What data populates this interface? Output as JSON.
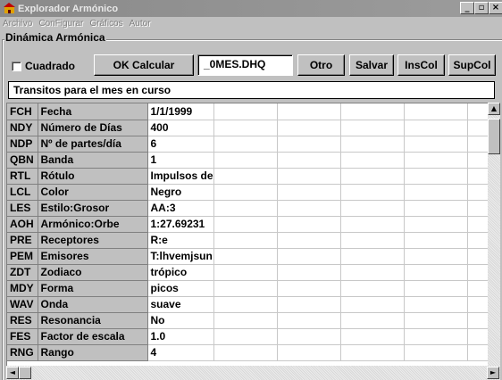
{
  "window": {
    "title": "Explorador Armónico",
    "buttons": [
      "_",
      "▫",
      "×"
    ]
  },
  "menu": [
    "Archivo",
    "ConFigurar",
    "Gráficos",
    "Autor"
  ],
  "group": {
    "title": "Dinámica Armónica"
  },
  "toolbar": {
    "checkbox_label": "Cuadrado",
    "checkbox_checked": false,
    "calc_label": "OK Calcular",
    "filename": "_0MES.DHQ",
    "otro_label": "Otro",
    "salvar_label": "Salvar",
    "inscol_label": "InsCol",
    "supcol_label": "SupCol"
  },
  "caption": "Transitos para el mes en curso",
  "rows": [
    {
      "code": "FCH",
      "label": "Fecha",
      "value": "1/1/1999"
    },
    {
      "code": "NDY",
      "label": "Número de Días",
      "value": "400"
    },
    {
      "code": "NDP",
      "label": "Nº de partes/día",
      "value": "6"
    },
    {
      "code": "QBN",
      "label": "Banda",
      "value": "1"
    },
    {
      "code": "RTL",
      "label": "Rótulo",
      "value": "Impulsos de"
    },
    {
      "code": "LCL",
      "label": "Color",
      "value": "Negro"
    },
    {
      "code": "LES",
      "label": "Estilo:Grosor",
      "value": "AA:3"
    },
    {
      "code": "AOH",
      "label": "Armónico:Orbe",
      "value": "1:27.69231"
    },
    {
      "code": "PRE",
      "label": "Receptores",
      "value": "R:e"
    },
    {
      "code": "PEM",
      "label": "Emisores",
      "value": "T:lhvemjsun"
    },
    {
      "code": "ZDT",
      "label": "Zodiaco",
      "value": "trópico"
    },
    {
      "code": "MDY",
      "label": "Forma",
      "value": "picos"
    },
    {
      "code": "WAV",
      "label": "Onda",
      "value": "suave"
    },
    {
      "code": "RES",
      "label": "Resonancia",
      "value": "No"
    },
    {
      "code": "FES",
      "label": "Factor de escala",
      "value": "1.0"
    },
    {
      "code": "RNG",
      "label": "Rango",
      "value": "4"
    }
  ]
}
